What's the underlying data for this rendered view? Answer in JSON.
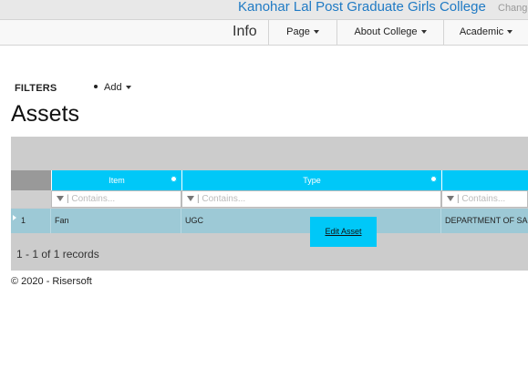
{
  "header": {
    "college_name": "Kanohar Lal Post Graduate Girls College",
    "change_link": "Change"
  },
  "nav": {
    "brand": "Info",
    "items": [
      {
        "label": "Page"
      },
      {
        "label": "About College"
      },
      {
        "label": "Academic"
      }
    ]
  },
  "filters": {
    "label": "FILTERS",
    "add_label": "Add"
  },
  "page": {
    "title": "Assets"
  },
  "grid": {
    "columns": [
      "Item",
      "Type",
      ""
    ],
    "filter_placeholder": "Contains...",
    "rows": [
      {
        "num": "1",
        "item": "Fan",
        "type": "UGC",
        "department": "DEPARTMENT OF SA"
      }
    ],
    "popup_action": "Edit Asset",
    "records_text": "1 - 1 of 1 records",
    "colors": {
      "header": "#00c8f8",
      "row": "#9dc9d6"
    }
  },
  "footer": {
    "text": "© 2020 - Risersoft"
  },
  "icons": [
    "caret-down-icon",
    "gear-icon",
    "funnel-icon",
    "expand-arrow-icon"
  ]
}
